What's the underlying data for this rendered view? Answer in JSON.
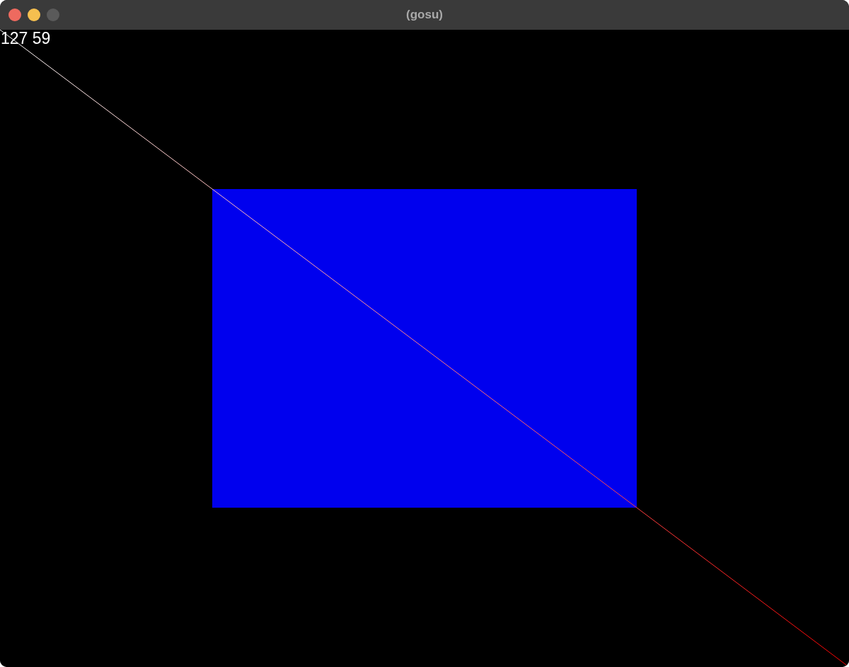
{
  "window": {
    "title": "(gosu)"
  },
  "canvas": {
    "readout": "127 59"
  }
}
